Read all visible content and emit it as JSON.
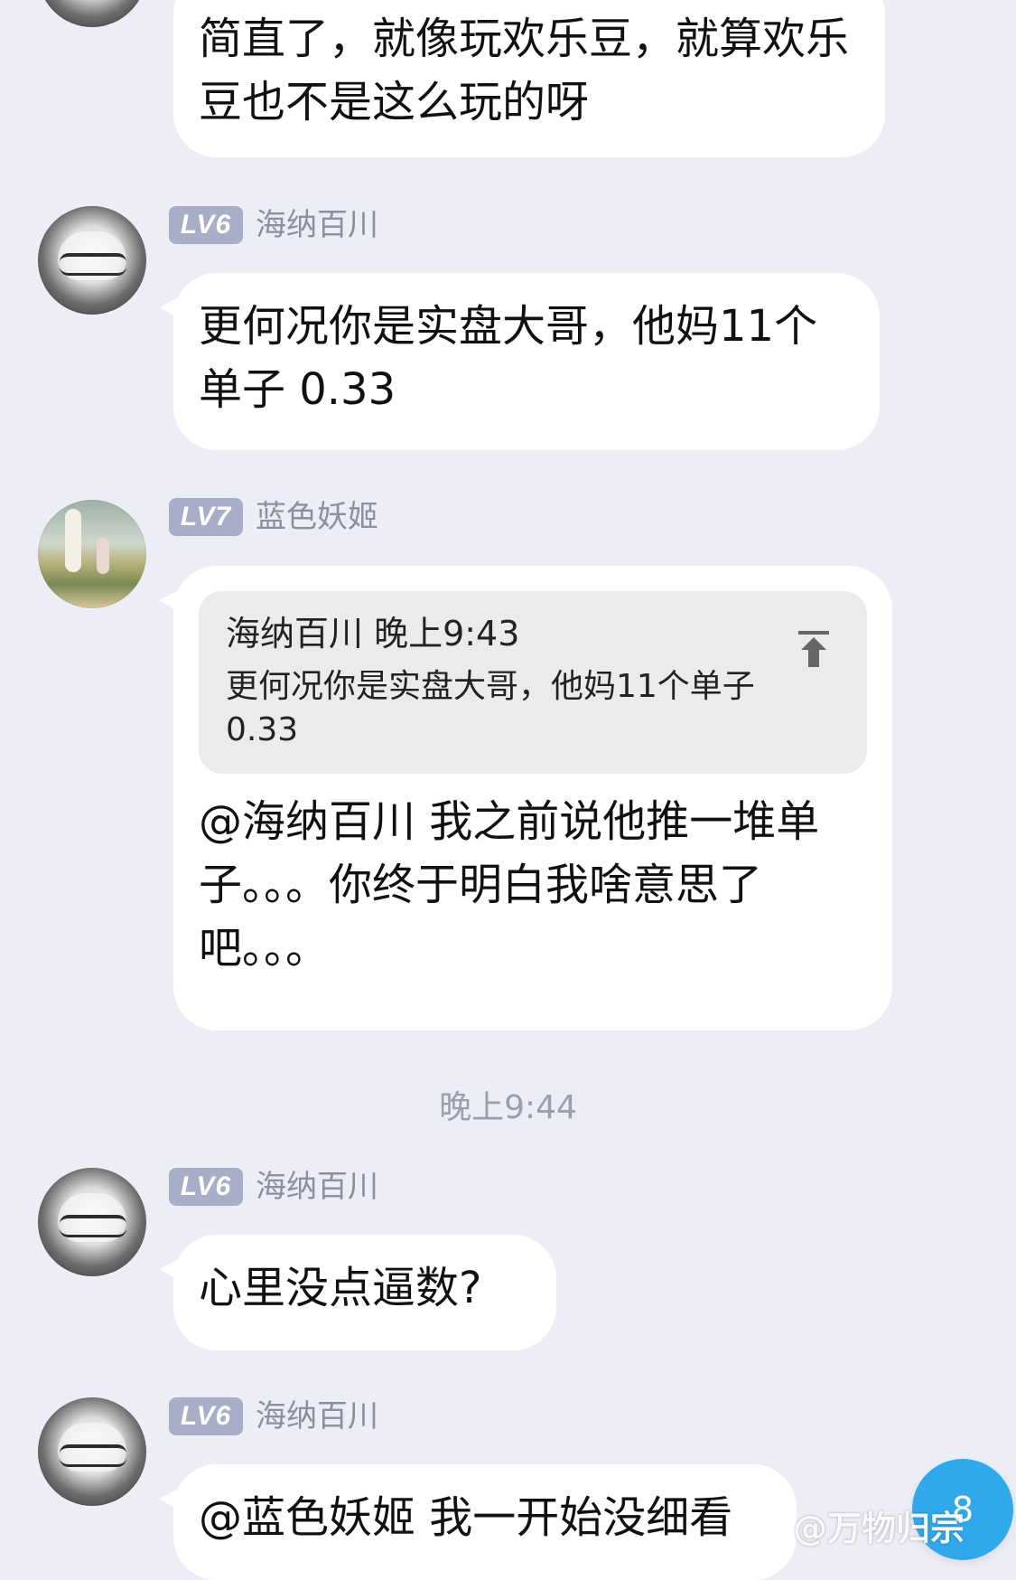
{
  "messages": [
    {
      "text": "简直了，就像玩欢乐豆，就算欢乐豆也不是这么玩的呀"
    },
    {
      "level": "LV6",
      "name": "海纳百川",
      "text": "更何况你是实盘大哥，他妈11个单子 0.33"
    },
    {
      "level": "LV7",
      "name": "蓝色妖姬",
      "quote": {
        "header": "海纳百川 晚上9:43",
        "text": "更何况你是实盘大哥，他妈11个单子 0.33"
      },
      "text": "@海纳百川 我之前说他推一堆单子。。。你终于明白我啥意思了吧。。。"
    },
    {
      "level": "LV6",
      "name": "海纳百川",
      "text": "心里没点逼数?"
    },
    {
      "level": "LV6",
      "name": "海纳百川",
      "text": "@蓝色妖姬 我一开始没细看"
    }
  ],
  "timestamp": "晚上9:44",
  "fab": {
    "count": "8"
  },
  "watermark": "@万物归宗",
  "icons": {
    "quote_jump": "jump-to-original-icon"
  },
  "colors": {
    "background": "#ededf6",
    "bubble": "#ffffff",
    "badge": "#a8aec7",
    "accent": "#2fa9ec"
  }
}
